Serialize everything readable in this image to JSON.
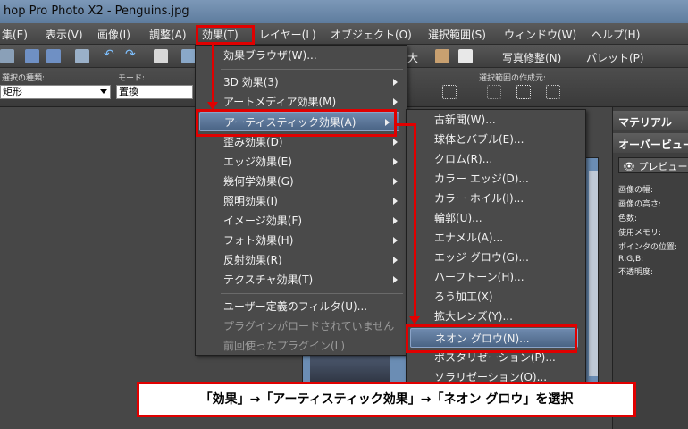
{
  "window": {
    "title": "hop Pro Photo X2 - Penguins.jpg"
  },
  "menubar": {
    "items": [
      {
        "label": "集(E)"
      },
      {
        "label": "表示(V)"
      },
      {
        "label": "画像(I)"
      },
      {
        "label": "調整(A)"
      },
      {
        "label": "効果(T)"
      },
      {
        "label": "レイヤー(L)"
      },
      {
        "label": "オブジェクト(O)"
      },
      {
        "label": "選択範囲(S)"
      },
      {
        "label": "ウィンドウ(W)"
      },
      {
        "label": "ヘルプ(H)"
      }
    ]
  },
  "toolbar": {
    "tail_char": "大",
    "retouch_label": "写真修整(N)",
    "palette_label": "パレット(P)"
  },
  "options": {
    "select_type_label": "選択の種類:",
    "select_type_value": "矩形",
    "mode_label": "モード:",
    "mode_value": "置換",
    "create_label": "選択範囲の作成元:"
  },
  "effects_menu": {
    "items": [
      {
        "label": "効果ブラウザ(W)...",
        "sub": false
      },
      {
        "label": "3D 効果(3)",
        "sub": true
      },
      {
        "label": "アートメディア効果(M)",
        "sub": true
      },
      {
        "label": "アーティスティック効果(A)",
        "sub": true
      },
      {
        "label": "歪み効果(D)",
        "sub": true
      },
      {
        "label": "エッジ効果(E)",
        "sub": true
      },
      {
        "label": "幾何学効果(G)",
        "sub": true
      },
      {
        "label": "照明効果(I)",
        "sub": true
      },
      {
        "label": "イメージ効果(F)",
        "sub": true
      },
      {
        "label": "フォト効果(H)",
        "sub": true
      },
      {
        "label": "反射効果(R)",
        "sub": true
      },
      {
        "label": "テクスチャ効果(T)",
        "sub": true
      },
      {
        "label": "ユーザー定義のフィルタ(U)...",
        "sub": false
      },
      {
        "label": "プラグインがロードされていません",
        "sub": false
      },
      {
        "label": "前回使ったプラグイン(L)",
        "sub": false
      }
    ]
  },
  "artistic_menu": {
    "items": [
      {
        "label": "古新聞(W)..."
      },
      {
        "label": "球体とバブル(E)..."
      },
      {
        "label": "クロム(R)..."
      },
      {
        "label": "カラー エッジ(D)..."
      },
      {
        "label": "カラー ホイル(I)..."
      },
      {
        "label": "輪郭(U)..."
      },
      {
        "label": "エナメル(A)..."
      },
      {
        "label": "エッジ グロウ(G)..."
      },
      {
        "label": "ハーフトーン(H)..."
      },
      {
        "label": "ろう加工(X)"
      },
      {
        "label": "拡大レンズ(Y)..."
      },
      {
        "label": "ネオン グロウ(N)..."
      },
      {
        "label": "ポスタリゼーション(P)..."
      },
      {
        "label": "ソラリゼーション(O)..."
      }
    ]
  },
  "right_panel": {
    "header1": "マテリアル",
    "header2": "オーバービュー",
    "preview_label": "プレビュー",
    "rows": [
      "画像の幅:",
      "画像の高さ:",
      "色数:",
      "使用メモリ:",
      "ポインタの位置:",
      "R,G,B:",
      "不透明度:"
    ]
  },
  "caption": "「効果」→「アーティスティック効果」→「ネオン グロウ」を選択",
  "colors": {
    "accent_red": "#e00000",
    "highlight": "#5a7598"
  }
}
